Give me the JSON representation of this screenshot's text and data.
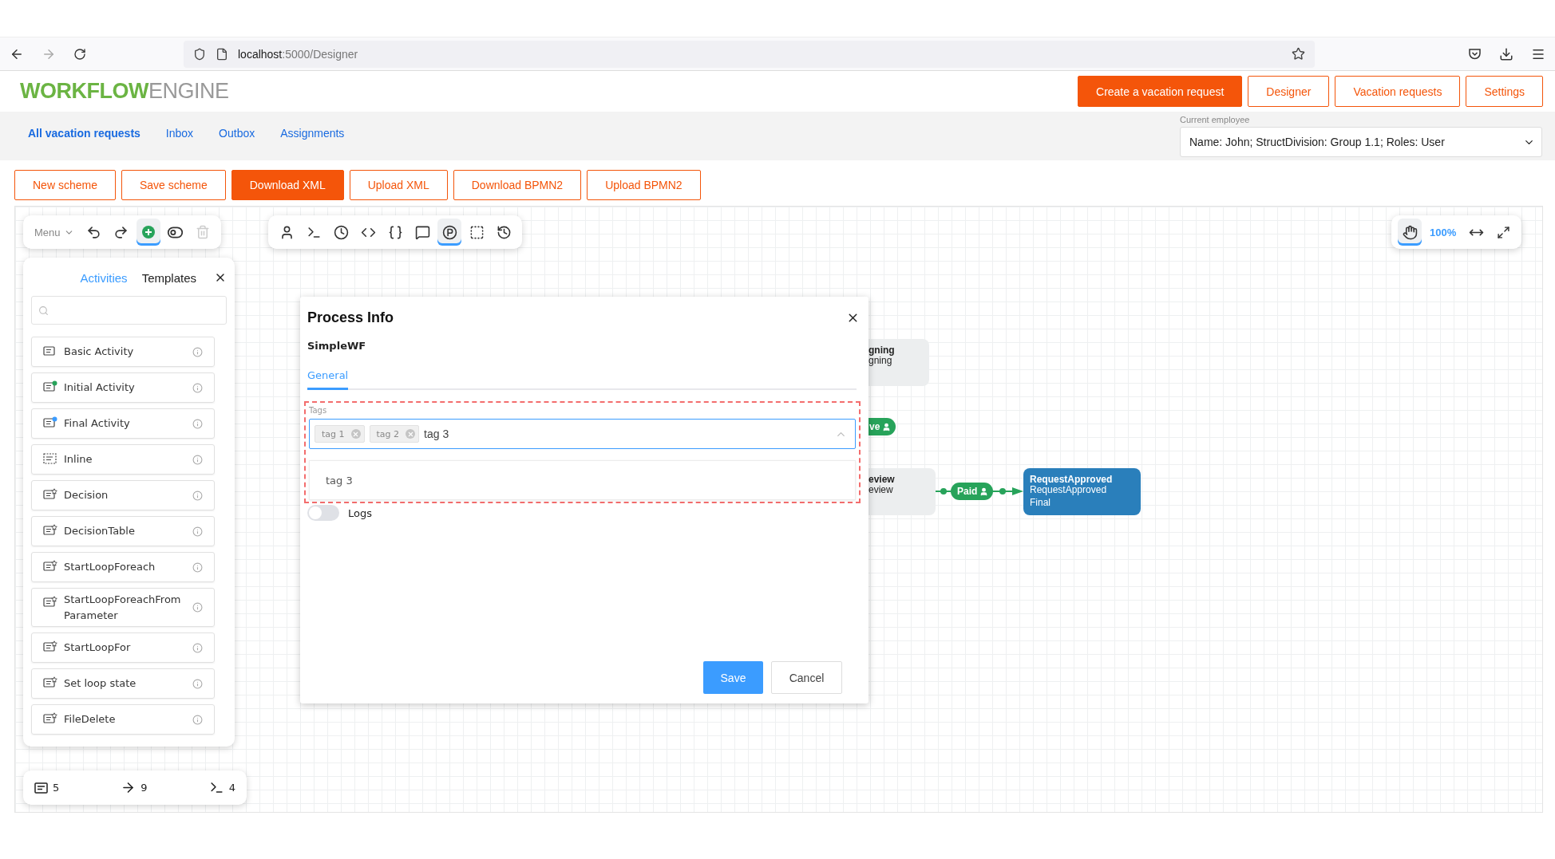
{
  "browser": {
    "url_host": "localhost",
    "url_path": ":5000/Designer"
  },
  "header": {
    "logo": {
      "bold": "WORKFLOW",
      "light": "ENGINE"
    },
    "nav_buttons": [
      {
        "label": "Create a vacation request",
        "selected": true
      },
      {
        "label": "Designer",
        "selected": false
      },
      {
        "label": "Vacation requests",
        "selected": false
      },
      {
        "label": "Settings",
        "selected": false
      }
    ]
  },
  "subnav": {
    "links": [
      {
        "label": "All vacation requests",
        "selected": true
      },
      {
        "label": "Inbox",
        "selected": false
      },
      {
        "label": "Outbox",
        "selected": false
      },
      {
        "label": "Assignments",
        "selected": false
      }
    ],
    "employee": {
      "label": "Current employee",
      "value": "Name: John; StructDivision: Group 1.1; Roles: User"
    }
  },
  "scheme_buttons": [
    {
      "label": "New scheme",
      "primary": false
    },
    {
      "label": "Save scheme",
      "primary": false
    },
    {
      "label": "Download XML",
      "primary": true
    },
    {
      "label": "Upload XML",
      "primary": false
    },
    {
      "label": "Download BPMN2",
      "primary": false
    },
    {
      "label": "Upload BPMN2",
      "primary": false
    }
  ],
  "edit_toolbar": {
    "menu": "Menu",
    "tools": [
      {
        "kind": "undo",
        "active": false,
        "disabled": false
      },
      {
        "kind": "redo",
        "active": false,
        "disabled": false
      },
      {
        "kind": "add",
        "active": true,
        "disabled": false
      },
      {
        "kind": "toggle",
        "active": false,
        "disabled": false
      },
      {
        "kind": "delete",
        "active": false,
        "disabled": true
      }
    ]
  },
  "tool_toolbar": [
    {
      "kind": "actor",
      "active": false
    },
    {
      "kind": "command",
      "active": false
    },
    {
      "kind": "timer",
      "active": false
    },
    {
      "kind": "code",
      "active": false
    },
    {
      "kind": "json",
      "active": false
    },
    {
      "kind": "comment",
      "active": false
    },
    {
      "kind": "parameter",
      "active": true
    },
    {
      "kind": "selection",
      "active": false
    },
    {
      "kind": "history",
      "active": false
    }
  ],
  "view_toolbar": {
    "pan_active": true,
    "zoom": "100%"
  },
  "palette": {
    "tabs": [
      {
        "label": "Activities",
        "selected": true
      },
      {
        "label": "Templates",
        "selected": false
      }
    ],
    "items": [
      {
        "label": "Basic Activity",
        "kind": "basic"
      },
      {
        "label": "Initial Activity",
        "kind": "initial"
      },
      {
        "label": "Final Activity",
        "kind": "final"
      },
      {
        "label": "Inline",
        "kind": "inline"
      },
      {
        "label": "Decision",
        "kind": "custom"
      },
      {
        "label": "DecisionTable",
        "kind": "custom"
      },
      {
        "label": "StartLoopForeach",
        "kind": "custom"
      },
      {
        "label": "StartLoopForeachFromParameter",
        "kind": "custom"
      },
      {
        "label": "StartLoopFor",
        "kind": "custom"
      },
      {
        "label": "Set loop state",
        "kind": "custom"
      },
      {
        "label": "FileDelete",
        "kind": "custom"
      }
    ]
  },
  "counters": [
    {
      "kind": "activity",
      "value": "5"
    },
    {
      "kind": "transition",
      "value": "9"
    },
    {
      "kind": "command",
      "value": "4"
    }
  ],
  "diagram": {
    "nodes": [
      {
        "kind": "activity",
        "title": "gning",
        "subtitle": "gning"
      },
      {
        "kind": "activity",
        "title": "eview",
        "subtitle": "eview"
      },
      {
        "kind": "final",
        "title": "RequestApproved",
        "subtitle": "RequestApproved",
        "note": "Final"
      }
    ],
    "pills": [
      {
        "label": "ve"
      },
      {
        "label": "Paid"
      }
    ]
  },
  "dialog": {
    "title": "Process Info",
    "scheme": "SimpleWF",
    "tabs": [
      {
        "label": "General",
        "selected": true
      }
    ],
    "tags_label": "Tags",
    "tags": [
      "tag 1",
      "tag 2"
    ],
    "input": "tag 3",
    "options": [
      "tag 3"
    ],
    "logs": {
      "label": "Logs",
      "on": false
    },
    "save": "Save",
    "cancel": "Cancel"
  }
}
